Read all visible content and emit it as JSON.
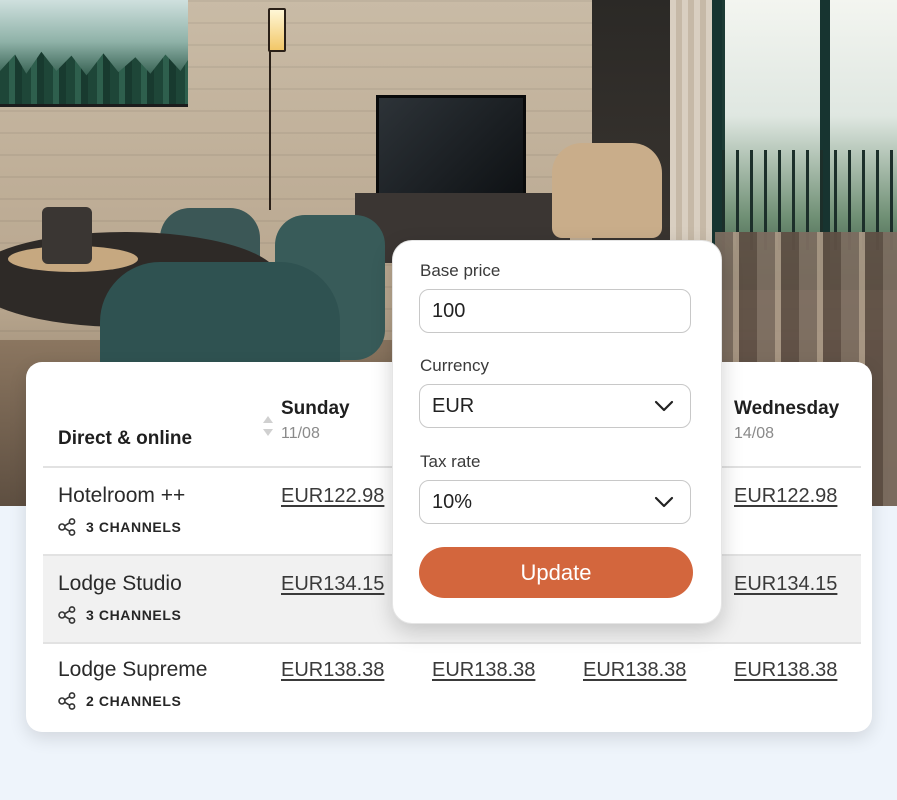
{
  "popup": {
    "base_price_label": "Base price",
    "base_price_value": "100",
    "currency_label": "Currency",
    "currency_value": "EUR",
    "tax_label": "Tax rate",
    "tax_value": "10%",
    "update_label": "Update",
    "accent_color": "#d3663d"
  },
  "table": {
    "header_title": "Direct & online",
    "days": [
      {
        "name": "Sunday",
        "date": "11/08"
      },
      {
        "name": "Wednesday",
        "date": "14/08"
      }
    ],
    "rows": [
      {
        "room": "Hotelroom ++",
        "channels": "3 CHANNELS",
        "prices": [
          "EUR122.98",
          "EUR122.98"
        ]
      },
      {
        "room": "Lodge Studio",
        "channels": "3 CHANNELS",
        "prices": [
          "EUR134.15",
          "EUR134.15"
        ]
      },
      {
        "room": "Lodge Supreme",
        "channels": "2 CHANNELS",
        "prices": [
          "EUR138.38",
          "EUR138.38",
          "EUR138.38",
          "EUR138.38"
        ]
      }
    ]
  },
  "icons": {
    "sort": "sort-icon",
    "channels": "share-icon",
    "dropdown": "chevron-down-icon"
  }
}
